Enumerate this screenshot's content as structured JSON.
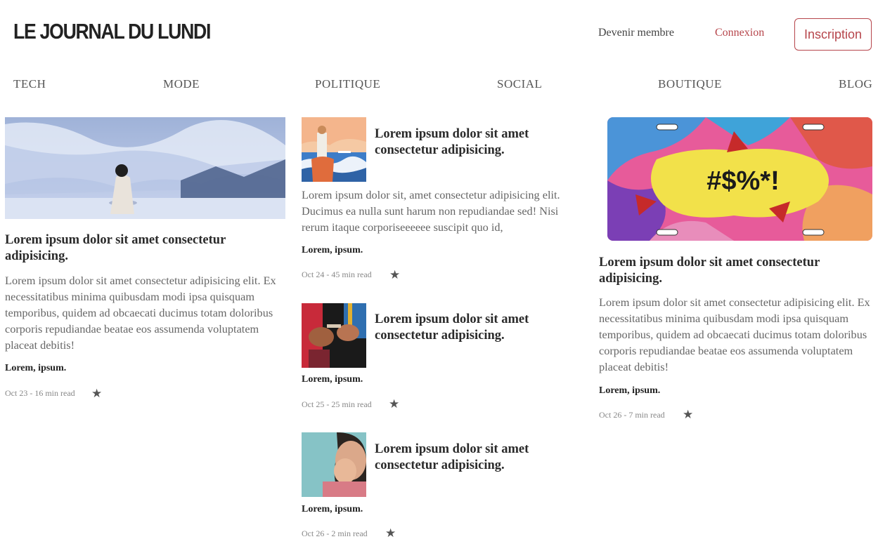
{
  "header": {
    "logo": "LE JOURNAL DU LUNDI",
    "member_label": "Devenir membre",
    "login_label": "Connexion",
    "signup_label": "Inscription"
  },
  "nav": {
    "items": [
      "TECH",
      "MODE",
      "POLITIQUE",
      "SOCIAL",
      "BOUTIQUE",
      "BLOG"
    ]
  },
  "colors": {
    "accent": "#b6454b",
    "text": "#333333",
    "muted": "#888888"
  },
  "articles": {
    "left": {
      "title": "Lorem ipsum dolor sit amet consectetur adipisicing.",
      "excerpt": "Lorem ipsum dolor sit amet consectetur adipisicing elit. Ex necessitatibus minima quibusdam modi ipsa quisquam temporibus, quidem ad obcaecati ducimus totam doloribus corporis repudiandae beatae eos assumenda voluptatem placeat debitis!",
      "author": "Lorem, ipsum.",
      "meta": "Oct 23 - 16 min read",
      "icon": "star-icon"
    },
    "middle": [
      {
        "title": "Lorem ipsum dolor sit amet consectetur adipisicing.",
        "excerpt": "Lorem ipsum dolor sit, amet consectetur adipisicing elit. Ducimus ea nulla sunt harum non repudiandae sed! Nisi rerum itaque corporiseeeeee suscipit quo id,",
        "author": "Lorem, ipsum.",
        "meta": "Oct 24 - 45 min read"
      },
      {
        "title": "Lorem ipsum dolor sit amet consectetur adipisicing.",
        "author": "Lorem, ipsum.",
        "meta": "Oct 25 - 25 min read"
      },
      {
        "title": "Lorem ipsum dolor sit amet consectetur adipisicing.",
        "author": "Lorem, ipsum.",
        "meta": "Oct 26 - 2 min read"
      }
    ],
    "right": {
      "image_text": "#$%*!",
      "title": "Lorem ipsum dolor sit amet consectetur adipisicing.",
      "excerpt": "Lorem ipsum dolor sit amet consectetur adipisicing elit. Ex necessitatibus minima quibusdam modi ipsa quisquam temporibus, quidem ad obcaecati ducimus totam doloribus corporis repudiandae beatae eos assumenda voluptatem placeat debitis!",
      "author": "Lorem, ipsum.",
      "meta": "Oct 26 - 7 min read"
    }
  }
}
